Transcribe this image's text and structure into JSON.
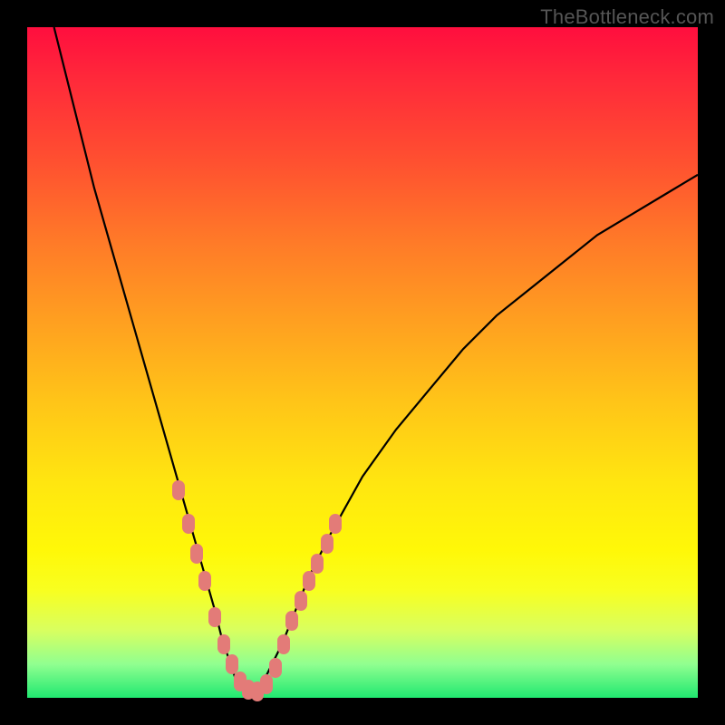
{
  "watermark": "TheBottleneck.com",
  "chart_data": {
    "type": "line",
    "title": "",
    "xlabel": "",
    "ylabel": "",
    "xlim": [
      0,
      100
    ],
    "ylim": [
      0,
      100
    ],
    "grid": false,
    "series": [
      {
        "name": "bottleneck-curve",
        "x": [
          4,
          6,
          8,
          10,
          12,
          14,
          16,
          18,
          20,
          22,
          24,
          26,
          28,
          29,
          30,
          31,
          32,
          33,
          34,
          35,
          36,
          38,
          40,
          42,
          45,
          50,
          55,
          60,
          65,
          70,
          75,
          80,
          85,
          90,
          95,
          100
        ],
        "y": [
          100,
          92,
          84,
          76,
          69,
          62,
          55,
          48,
          41,
          34,
          27,
          20,
          13,
          9,
          6,
          3,
          2,
          1,
          1,
          2,
          4,
          8,
          13,
          18,
          24,
          33,
          40,
          46,
          52,
          57,
          61,
          65,
          69,
          72,
          75,
          78
        ]
      }
    ],
    "highlight_points": {
      "name": "sample-markers",
      "x": [
        22.5,
        24.0,
        25.3,
        26.5,
        28.0,
        29.3,
        30.5,
        31.7,
        33.0,
        34.3,
        35.7,
        37.0,
        38.3,
        39.5,
        40.8,
        42.0,
        43.3,
        44.7,
        46.0
      ],
      "y": [
        31.0,
        26.0,
        21.5,
        17.5,
        12.0,
        8.0,
        5.0,
        2.5,
        1.2,
        1.0,
        2.0,
        4.5,
        8.0,
        11.5,
        14.5,
        17.5,
        20.0,
        23.0,
        26.0
      ]
    },
    "background_gradient": {
      "top": "#ff0e3e",
      "mid_upper": "#ff7a28",
      "mid": "#ffe610",
      "mid_lower": "#d8ff60",
      "bottom": "#20e870"
    },
    "curve_stroke": "#000000",
    "marker_color": "#e37b78"
  }
}
